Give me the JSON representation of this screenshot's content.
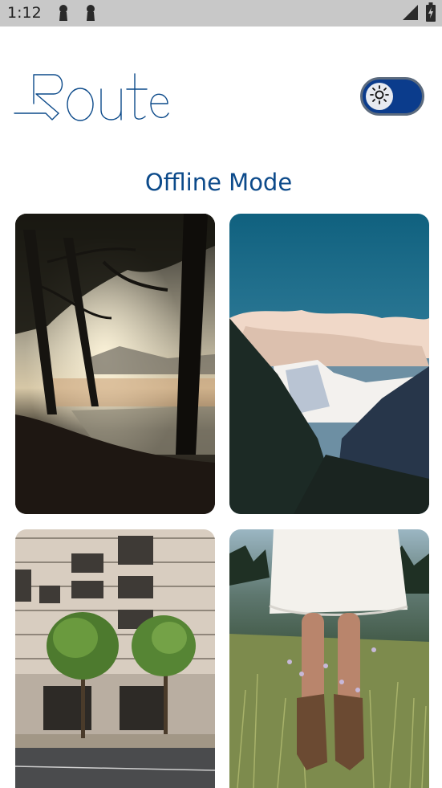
{
  "status_bar": {
    "time": "1:12",
    "icons": [
      "keyhole-icon",
      "keyhole-icon",
      "signal-icon",
      "battery-icon"
    ]
  },
  "header": {
    "logo_text": "Route",
    "theme_toggle": {
      "state": "on",
      "icon": "sun-icon",
      "accent": "#0b3c8c"
    }
  },
  "main": {
    "title": "Offline Mode",
    "gallery": [
      {
        "subject": "forest lake at sunrise"
      },
      {
        "subject": "snowy mountain peak"
      },
      {
        "subject": "building with trees"
      },
      {
        "subject": "person in white dress in meadow"
      }
    ]
  }
}
